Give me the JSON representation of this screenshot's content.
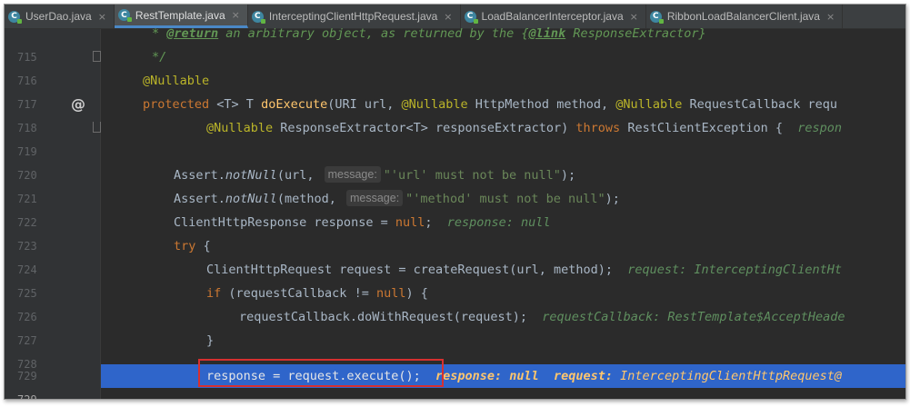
{
  "tabs": [
    {
      "label": "UserDao.java",
      "icon": "java-class-icon",
      "close": "×"
    },
    {
      "label": "RestTemplate.java",
      "icon": "java-class-icon",
      "close": "×",
      "active": true
    },
    {
      "label": "InterceptingClientHttpRequest.java",
      "icon": "java-class-icon",
      "close": "×"
    },
    {
      "label": "LoadBalancerInterceptor.java",
      "icon": "java-class-icon",
      "close": "×"
    },
    {
      "label": "RibbonLoadBalancerClient.java",
      "icon": "java-class-icon",
      "close": "×"
    }
  ],
  "tab_icon_glyph": "C",
  "gutter_icons": {
    "override": "@"
  },
  "lines": {
    "l715": {
      "num": "715",
      "doc_prefix": "* ",
      "doc_tag1": "@return",
      "doc_mid": " an arbitrary object, as returned by the {",
      "doc_tag2": "@link",
      "doc_end": " ResponseExtractor}"
    },
    "l716": {
      "num": "716",
      "doc": "*/"
    },
    "l717": {
      "num": "717",
      "ann": "@Nullable"
    },
    "l718": {
      "num": "718",
      "kw": "protected",
      "t1": " <T> T ",
      "fn": "doExecute",
      "t2": "(URI url, ",
      "ann1": "@Nullable",
      "t3": " HttpMethod method, ",
      "ann2": "@Nullable",
      "t4": " RequestCallback requ"
    },
    "l719": {
      "num": "719",
      "ann": "@Nullable",
      "t1": " ResponseExtractor<T> responseExtractor) ",
      "kw": "throws",
      "t2": " RestClientException {  ",
      "inlay": "respon"
    },
    "l720": {
      "num": "720"
    },
    "l721": {
      "num": "721",
      "t1": "Assert.",
      "method": "notNull",
      "t2": "(url, ",
      "hint": "message:",
      "str": "\"'url' must not be null\"",
      "t3": ");"
    },
    "l722": {
      "num": "722",
      "t1": "Assert.",
      "method": "notNull",
      "t2": "(method, ",
      "hint": "message:",
      "str": "\"'method' must not be null\"",
      "t3": ");"
    },
    "l723": {
      "num": "723",
      "t1": "ClientHttpResponse response = ",
      "kw": "null",
      "t2": ";  ",
      "inlay": "response: null"
    },
    "l724": {
      "num": "724",
      "kw": "try",
      "t1": " {"
    },
    "l725": {
      "num": "725",
      "t1": "ClientHttpRequest request = createRequest(url, method);  ",
      "inlay": "request: InterceptingClientHt"
    },
    "l726": {
      "num": "726",
      "kw": "if",
      "t1": " (requestCallback != ",
      "kw2": "null",
      "t2": ") {"
    },
    "l727": {
      "num": "727",
      "t1": "requestCallback.doWithRequest(request);  ",
      "inlay": "requestCallback: RestTemplate$AcceptHeade"
    },
    "l728": {
      "num": "728",
      "t1": "}"
    },
    "l729": {
      "num": "729",
      "t1": "response = request.execute();  ",
      "inlay1": "response: null  request: ",
      "inlay2": "InterceptingClientHttpRequest@"
    }
  },
  "colors": {
    "background": "#2b2b2b",
    "gutter": "#313335",
    "current_line": "#2f65ca",
    "keyword": "#cc7832",
    "annotation": "#bbb529",
    "string": "#6a8759",
    "function": "#ffc66d",
    "highlight_box": "#d63030"
  }
}
